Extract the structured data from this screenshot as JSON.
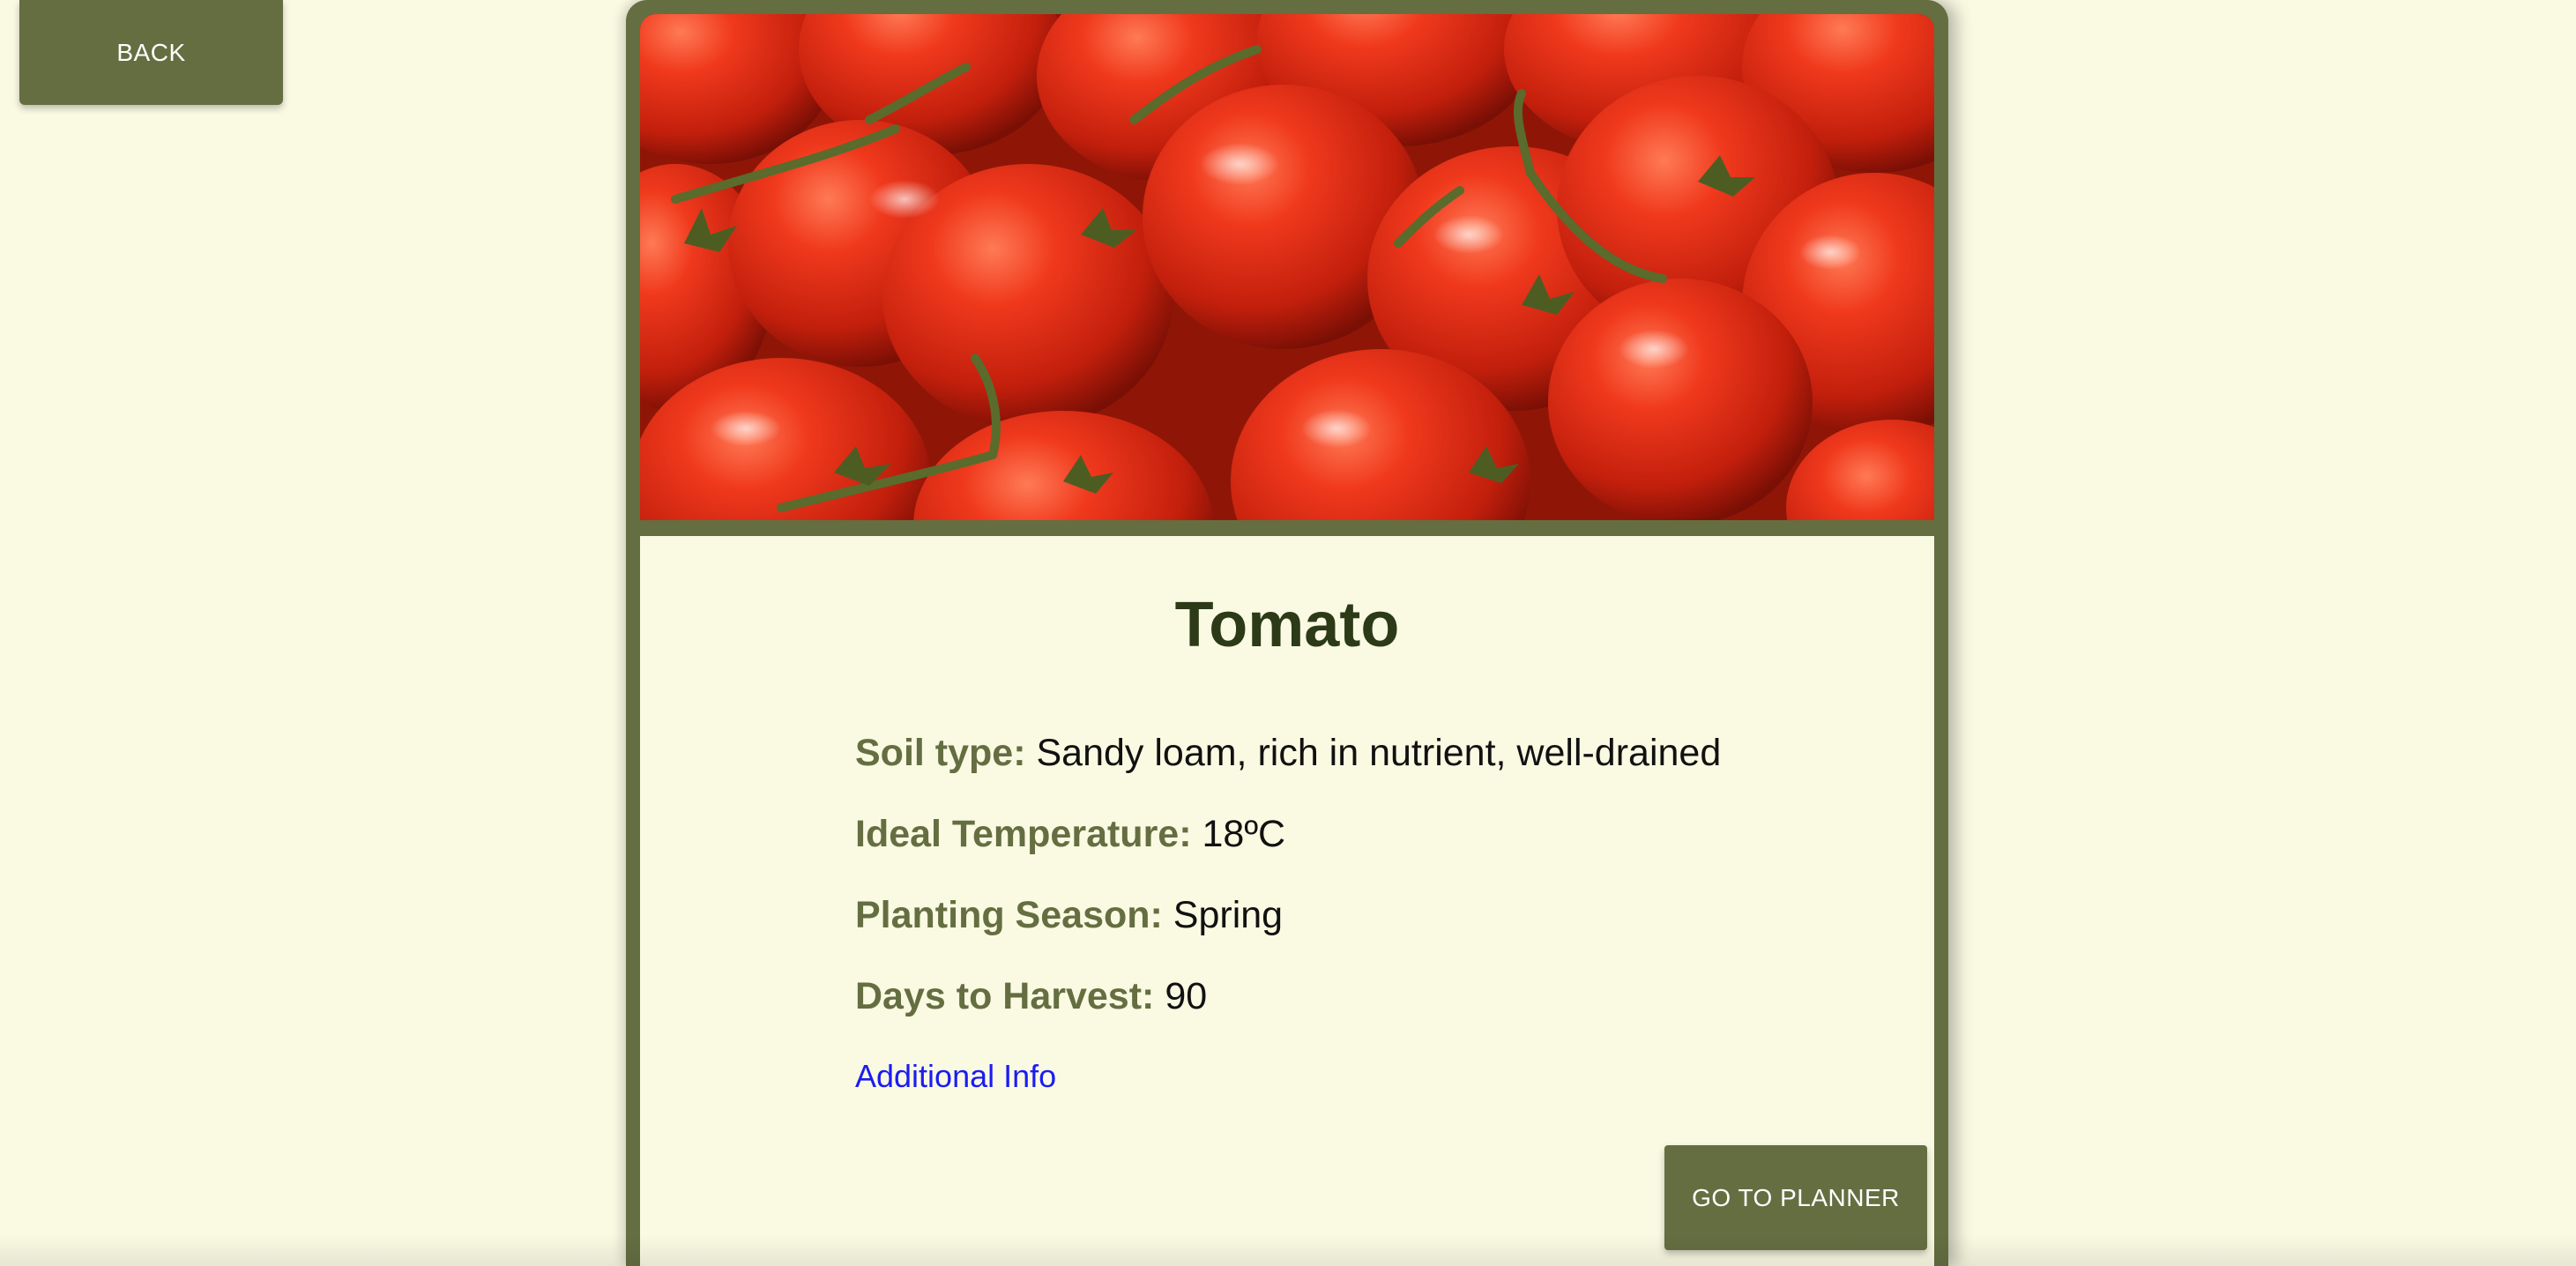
{
  "nav": {
    "back_label": "BACK"
  },
  "plant": {
    "image_alt": "Tomatoes",
    "name": "Tomato",
    "details": [
      {
        "label": "Soil type:",
        "value": "Sandy loam, rich in nutrient, well-drained"
      },
      {
        "label": "Ideal Temperature:",
        "value": "18ºC"
      },
      {
        "label": "Planting Season:",
        "value": "Spring"
      },
      {
        "label": "Days to Harvest:",
        "value": "90"
      }
    ],
    "additional_info_label": "Additional Info"
  },
  "actions": {
    "planner_label": "GO TO PLANNER"
  },
  "colors": {
    "background": "#fafae3",
    "accent": "#656e41",
    "title": "#2c3a17",
    "link": "#1c1cf2"
  },
  "icons": {
    "hero": "tomato-photo"
  }
}
